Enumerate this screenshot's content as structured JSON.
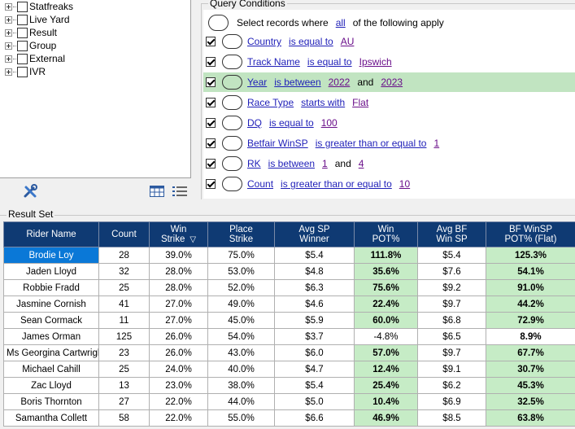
{
  "tree": {
    "items": [
      {
        "label": "Statfreaks"
      },
      {
        "label": "Live Yard"
      },
      {
        "label": "Result"
      },
      {
        "label": "Group"
      },
      {
        "label": "External"
      },
      {
        "label": "IVR"
      }
    ]
  },
  "tools": {
    "clear_icon": "wrench-cross-icon",
    "layout_icon": "grid-layout-icon",
    "list_icon": "list-view-icon"
  },
  "query": {
    "legend": "Query Conditions",
    "select_prefix": "Select records where",
    "select_mode": "all",
    "select_suffix": "of the following apply",
    "conditions": [
      {
        "field": "Country",
        "op": "is equal to",
        "value": "AU"
      },
      {
        "field": "Track Name",
        "op": "is equal to",
        "value": "Ipswich"
      },
      {
        "field": "Year",
        "op": "is between",
        "value": "2022",
        "joiner": "and",
        "value2": "2023"
      },
      {
        "field": "Race Type",
        "op": "starts with",
        "value": "Flat"
      },
      {
        "field": "DQ",
        "op": "is equal to",
        "value": "100"
      },
      {
        "field": "Betfair WinSP",
        "op": "is greater than or equal to",
        "value": "1"
      },
      {
        "field": "RK",
        "op": "is between",
        "value": "1",
        "joiner": "and",
        "value2": "4"
      },
      {
        "field": "Count",
        "op": "is greater than or equal to",
        "value": "10"
      }
    ]
  },
  "results": {
    "legend": "Result Set",
    "columns": [
      {
        "l1": "Rider Name",
        "l2": ""
      },
      {
        "l1": "Count",
        "l2": ""
      },
      {
        "l1": "Win",
        "l2": "Strike"
      },
      {
        "l1": "Place",
        "l2": "Strike"
      },
      {
        "l1": "Avg SP",
        "l2": "Winner"
      },
      {
        "l1": "Win",
        "l2": "POT%"
      },
      {
        "l1": "Avg BF",
        "l2": "Win SP"
      },
      {
        "l1": "BF WinSP",
        "l2": "POT% (Flat)"
      }
    ],
    "rows": [
      [
        "Brodie Loy",
        "28",
        "39.0%",
        "75.0%",
        "$5.4",
        "111.8%",
        "$5.4",
        "125.3%"
      ],
      [
        "Jaden Lloyd",
        "32",
        "28.0%",
        "53.0%",
        "$4.8",
        "35.6%",
        "$7.6",
        "54.1%"
      ],
      [
        "Robbie Fradd",
        "25",
        "28.0%",
        "52.0%",
        "$6.3",
        "75.6%",
        "$9.2",
        "91.0%"
      ],
      [
        "Jasmine Cornish",
        "41",
        "27.0%",
        "49.0%",
        "$4.6",
        "22.4%",
        "$9.7",
        "44.2%"
      ],
      [
        "Sean Cormack",
        "11",
        "27.0%",
        "45.0%",
        "$5.9",
        "60.0%",
        "$6.8",
        "72.9%"
      ],
      [
        "James Orman",
        "125",
        "26.0%",
        "54.0%",
        "$3.7",
        "-4.8%",
        "$6.5",
        "8.9%"
      ],
      [
        "Ms Georgina Cartwright",
        "23",
        "26.0%",
        "43.0%",
        "$6.0",
        "57.0%",
        "$9.7",
        "67.7%"
      ],
      [
        "Michael Cahill",
        "25",
        "24.0%",
        "40.0%",
        "$4.7",
        "12.4%",
        "$9.1",
        "30.7%"
      ],
      [
        "Zac Lloyd",
        "13",
        "23.0%",
        "38.0%",
        "$5.4",
        "25.4%",
        "$6.2",
        "45.3%"
      ],
      [
        "Boris Thornton",
        "27",
        "22.0%",
        "44.0%",
        "$5.0",
        "10.4%",
        "$6.9",
        "32.5%"
      ],
      [
        "Samantha Collett",
        "58",
        "22.0%",
        "55.0%",
        "$6.6",
        "46.9%",
        "$8.5",
        "63.8%"
      ]
    ],
    "positive_fill": "#c6ecc6",
    "selected_fill": "#0a78d7",
    "header_fill": "#0f3a73"
  }
}
